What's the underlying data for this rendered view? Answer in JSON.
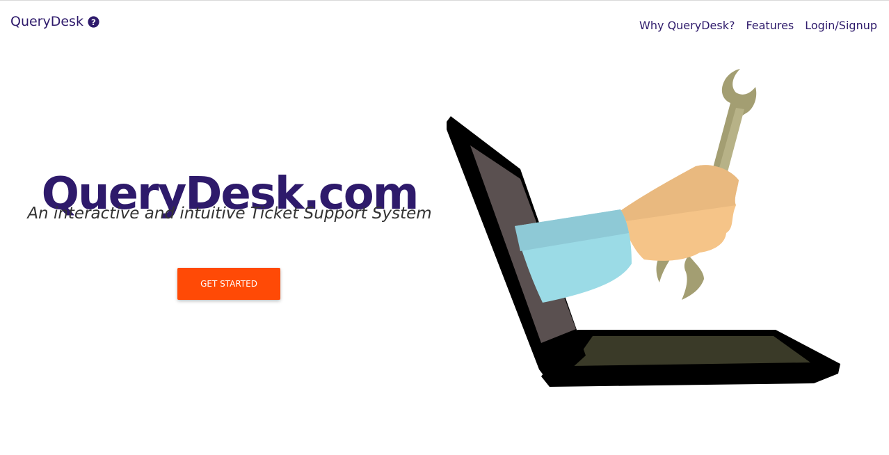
{
  "header": {
    "brand": "QueryDesk",
    "brand_icon": "question-circle-icon",
    "nav": [
      "Why QueryDesk?",
      "Features",
      "Login/Signup"
    ]
  },
  "hero": {
    "title": "QueryDesk.com",
    "subtitle": "An interactive and intuitive Ticket Support System",
    "cta_label": "GET STARTED"
  },
  "illustration": {
    "subject": "laptop-with-hand-holding-wrench",
    "colors": {
      "laptop": "#000000",
      "screen": "#5a5050",
      "keyboard": "#3a3a28",
      "wrench": "#a39e72",
      "hand": "#f5c488",
      "sleeve": "#9bdbe6"
    }
  },
  "theme": {
    "primary": "#2e1a6b",
    "accent": "#ff4a06"
  }
}
